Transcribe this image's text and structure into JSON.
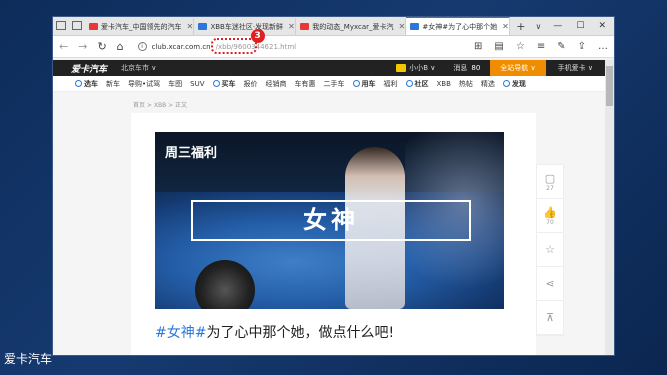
{
  "browser": {
    "tabs": [
      {
        "label": "爱卡汽车_中国领先的汽车",
        "color": "#e53935"
      },
      {
        "label": "XBB车迷社区·发现新鲜",
        "color": "#2b78d8"
      },
      {
        "label": "我的动态_Myxcar_爱卡汽",
        "color": "#e53935"
      },
      {
        "label": "#女神#为了心中那个她",
        "color": "#2b78d8"
      }
    ],
    "new_tab": "+",
    "tab_menu": "∨",
    "window_controls": [
      "—",
      "☐",
      "✕"
    ],
    "nav": {
      "back": "←",
      "forward": "→",
      "refresh": "↻",
      "home": "⌂"
    },
    "url_host": "club.xcar.com.cn",
    "url_path": "/xbb/9600344621.html",
    "annotation_number": "3",
    "toolbar_icons": [
      "⊞",
      "▤",
      "☆",
      "≡",
      "✎",
      "⇪",
      "…"
    ]
  },
  "site": {
    "logo": "爱卡汽车",
    "city": "北京车市 ∨",
    "user": "小小B ∨",
    "messages_label": "消息",
    "messages_count": "80",
    "nav_dropdown": "全站导航 ∨",
    "mobile": "手机爱卡 ∨",
    "categories": [
      {
        "label": "选车",
        "group": true
      },
      {
        "label": "新车"
      },
      {
        "label": "导购•试驾"
      },
      {
        "label": "车图"
      },
      {
        "label": "SUV"
      },
      {
        "label": "买车",
        "group": true
      },
      {
        "label": "报价"
      },
      {
        "label": "经销商"
      },
      {
        "label": "车有惠"
      },
      {
        "label": "二手车"
      },
      {
        "label": "用车",
        "group": true
      },
      {
        "label": "福利"
      },
      {
        "label": "社区",
        "group": true
      },
      {
        "label": "XBB"
      },
      {
        "label": "热帖"
      },
      {
        "label": "精选"
      },
      {
        "label": "发现",
        "group": true
      }
    ],
    "breadcrumb": "首页 > XBB > 正文"
  },
  "article": {
    "hero_tag": "周三福利",
    "hero_title": "女神",
    "title_hashtag": "#女神#",
    "title_text": "为了心中那个她，做点什么吧!"
  },
  "sidebar": {
    "comments_icon": "▢",
    "comments_count": "27",
    "likes_icon": "👍",
    "likes_count": "70",
    "fav_icon": "☆",
    "share_icon": "⋖",
    "top_icon": "⊼"
  },
  "watermark": "爱卡汽车"
}
